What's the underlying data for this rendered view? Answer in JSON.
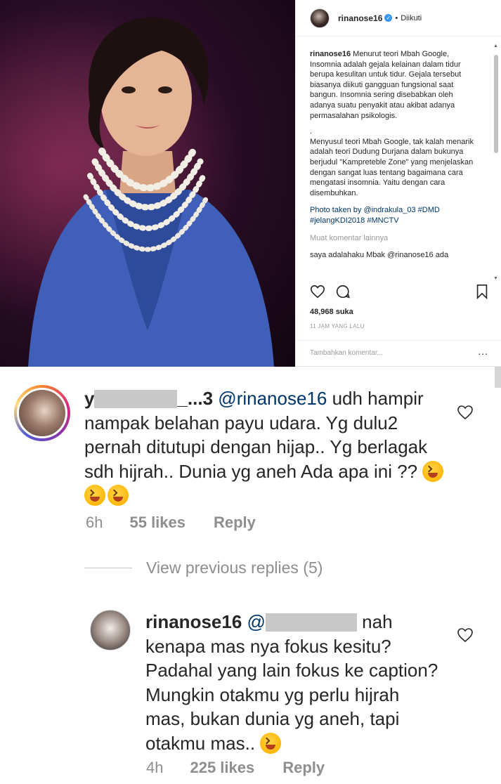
{
  "post": {
    "username": "rinanose16",
    "follow_status": "Diikuti",
    "caption_user": "rinanose16",
    "caption_p1": "Menurut teori Mbah Google, Insomnia adalah gejala kelainan dalam tidur berupa kesulitan untuk tidur. Gejala tersebut biasanya diikuti gangguan fungsional saat bangun. Insomnia sering disebabkan oleh adanya suatu penyakit atau akibat adanya permasalahan psikologis.",
    "caption_p2": "Menyusul teori Mbah Google, tak kalah menarik adalah teori Dudung Durjana dalam bukunya berjudul \"Kampreteble Zone\" yang menjelaskan dengan sangat luas tentang bagaimana cara mengatasi insomnia. Yaitu dengan cara disembuhkan.",
    "caption_p3": "Photo taken by @indrakula_03 #DMD #jelangKDI2018 #MNCTV",
    "more_comments": "Muat komentar lainnya",
    "partial_comment": "saya adalahaku Mbak @rinanose16 ada",
    "likes": "48,968 suka",
    "time": "11 JAM YANG LALU",
    "add_comment_placeholder": "Tambahkan komentar...",
    "more_label": "..."
  },
  "comment1": {
    "username_visible_start": "y",
    "username_visible_end": "_...3",
    "mention": "@rinanose16",
    "text": " udh hampir nampak belahan payu udara. Yg dulu2 pernah ditutupi dengan hijap.. Yg berlagak sdh hijrah.. Dunia yg aneh Ada apa ini ?? ",
    "time": "6h",
    "likes": "55 likes",
    "reply": "Reply"
  },
  "view_previous": "View previous replies (5)",
  "comment2": {
    "username": "rinanose16",
    "mention_start": "@",
    "text": " nah kenapa mas nya fokus kesitu? Padahal yang lain fokus ke caption? Mungkin otakmu yg perlu hijrah mas, bukan dunia yg aneh, tapi otakmu mas.. ",
    "time": "4h",
    "likes": "225 likes",
    "reply": "Reply"
  },
  "colors": {
    "verified": "#3897f0",
    "link": "#003569",
    "muted": "#8e8e8e"
  }
}
